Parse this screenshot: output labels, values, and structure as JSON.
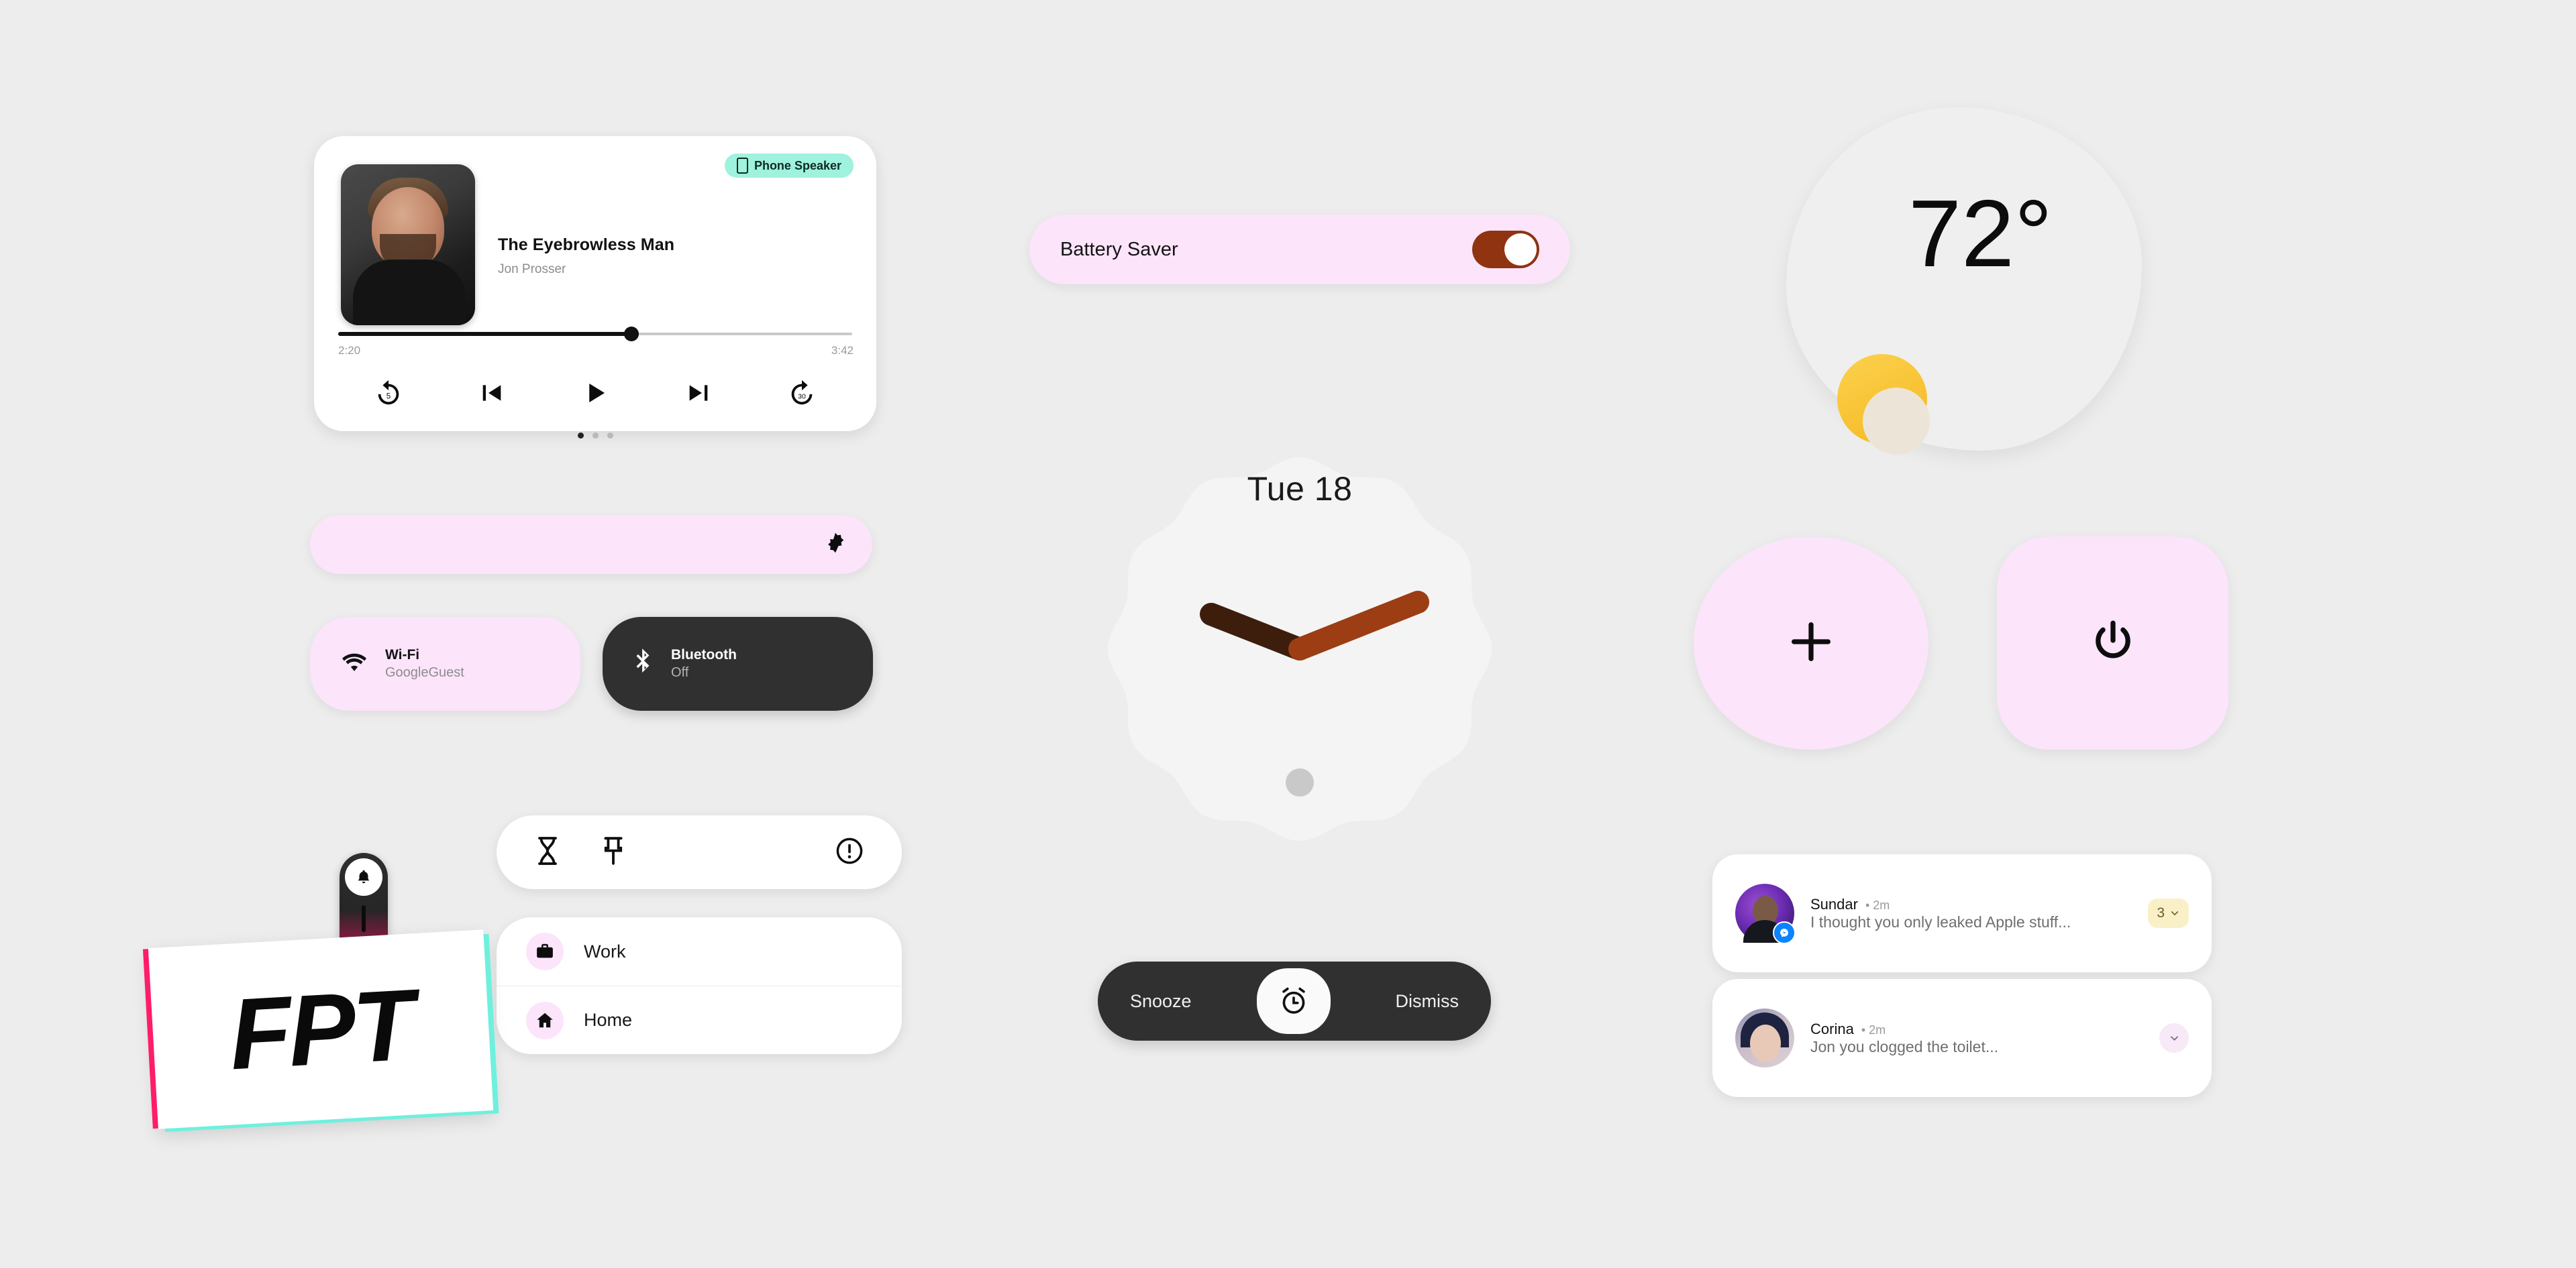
{
  "media_player": {
    "track_title": "The Eyebrowless Man",
    "artist": "Jon Prosser",
    "output_chip": "Phone Speaker",
    "output_icon": "phone-icon",
    "time_current": "2:20",
    "time_total": "3:42",
    "progress_percent": 57,
    "controls": [
      {
        "name": "replay-5-button",
        "label": "5"
      },
      {
        "name": "previous-track-button",
        "label": ""
      },
      {
        "name": "play-button",
        "label": ""
      },
      {
        "name": "next-track-button",
        "label": ""
      },
      {
        "name": "forward-30-button",
        "label": "30"
      }
    ],
    "page_dots": 3,
    "active_dot": 1
  },
  "brightness": {
    "icon": "brightness-icon",
    "level_percent": 100
  },
  "quick_tiles": {
    "wifi": {
      "title": "Wi-Fi",
      "subtitle": "GoogleGuest",
      "icon": "wifi-icon",
      "state": "on"
    },
    "bluetooth": {
      "title": "Bluetooth",
      "subtitle": "Off",
      "icon": "bluetooth-icon",
      "state": "off"
    }
  },
  "quick_actions": {
    "items": [
      {
        "name": "hourglass-icon",
        "label": "hourglass"
      },
      {
        "name": "pin-icon",
        "label": "pin"
      },
      {
        "name": "info-icon",
        "label": "info"
      }
    ]
  },
  "shortcuts": [
    {
      "label": "Work",
      "icon": "briefcase-icon"
    },
    {
      "label": "Home",
      "icon": "home-icon"
    }
  ],
  "watermark": {
    "text": "FPT",
    "pin_icon": "bell-icon",
    "edge_color_left": "#ff1c6b",
    "edge_color_right": "#6ff0de"
  },
  "battery_saver": {
    "label": "Battery Saver",
    "enabled": true,
    "toggle_color": "#8f3311"
  },
  "clock": {
    "date_label": "Tue 18",
    "hour_hand_degrees": -115,
    "minute_hand_degrees": 58,
    "hand_color_hour": "#3d1d0c",
    "hand_color_minute": "#9c3d13"
  },
  "alarm_actions": {
    "snooze_label": "Snooze",
    "dismiss_label": "Dismiss",
    "center_icon": "alarm-clock-icon"
  },
  "weather": {
    "temperature": "72°",
    "condition_icon": "partly-sunny-icon",
    "sun_color": "#f5b821",
    "cloud_color": "#ece5d7"
  },
  "action_buttons": [
    {
      "name": "add-button",
      "icon": "plus-icon"
    },
    {
      "name": "power-button",
      "icon": "power-icon"
    }
  ],
  "notifications": [
    {
      "sender": "Sundar",
      "time": "• 2m",
      "message": "I thought you only leaked Apple stuff...",
      "badge_count": "3",
      "app_icon": "messenger-icon",
      "has_badge": true
    },
    {
      "sender": "Corina",
      "time": "• 2m",
      "message": "Jon you clogged the toilet...",
      "badge_count": "",
      "app_icon": "",
      "has_badge": false
    }
  ],
  "theme": {
    "background": "#ededed",
    "pink_surface": "#fce4fb",
    "dark_surface": "#303030",
    "mint_accent": "#9ff2dd"
  }
}
